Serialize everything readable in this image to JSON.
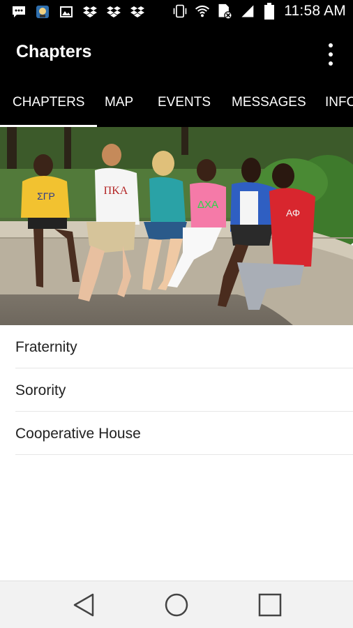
{
  "status_bar": {
    "time": "11:58 AM",
    "icons": [
      "message-icon",
      "app-icon",
      "image-icon",
      "dropbox-icon",
      "dropbox-icon",
      "dropbox-icon",
      "vibrate-icon",
      "wifi-icon",
      "sim-icon",
      "signal-icon",
      "battery-icon"
    ]
  },
  "app_bar": {
    "title": "Chapters",
    "menu_icon": "more-vert-icon"
  },
  "tabs": [
    {
      "label": "CHAPTERS",
      "active": true
    },
    {
      "label": "MAP",
      "active": false
    },
    {
      "label": "EVENTS",
      "active": false
    },
    {
      "label": "MESSAGES",
      "active": false
    },
    {
      "label": "INFO",
      "active": false
    }
  ],
  "hero": {
    "shirt_letters": [
      "ΣΓΡ",
      "ΠΚΑ",
      "ΔΧΑ",
      "ΑΦ"
    ]
  },
  "list": {
    "items": [
      {
        "label": "Fraternity"
      },
      {
        "label": "Sorority"
      },
      {
        "label": "Cooperative House"
      }
    ]
  },
  "nav_bar": {
    "icons": [
      "back-icon",
      "home-icon",
      "recents-icon"
    ]
  },
  "colors": {
    "bar_background": "#000000",
    "tab_indicator": "#ffffff",
    "divider": "#e6e6e6",
    "nav_background": "#f2f2f2"
  }
}
